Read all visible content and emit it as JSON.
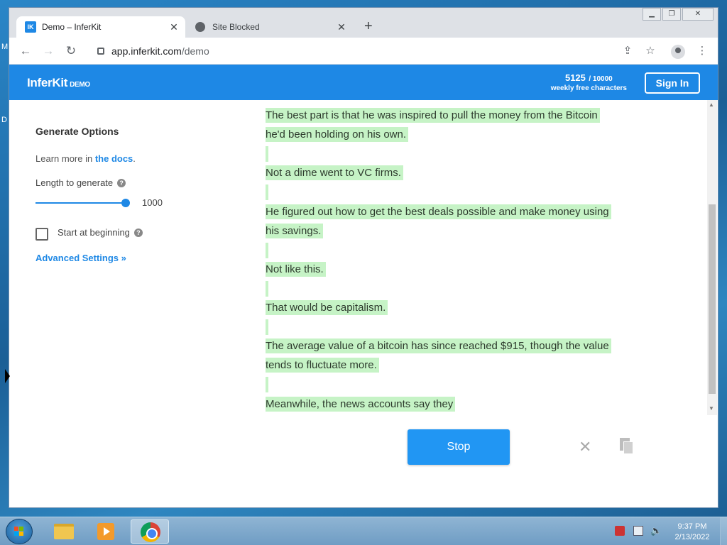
{
  "desktop": {
    "edge_letters": [
      "M",
      "D"
    ]
  },
  "browser": {
    "tabs": [
      {
        "label": "Demo – InferKit",
        "favicon": "IK",
        "active": true
      },
      {
        "label": "Site Blocked",
        "favicon": "globe-icon",
        "active": false
      }
    ],
    "new_tab_glyph": "+",
    "url_host": "app.inferkit.com",
    "url_path": "/demo"
  },
  "app": {
    "brand": "InferKit",
    "brand_tag": "DEMO",
    "credits_used": "5125",
    "credits_max": "/ 10000",
    "credits_label": "weekly free characters",
    "sign_in": "Sign In",
    "accent_color": "#1e88e5"
  },
  "options": {
    "title": "Generate Options",
    "docs_prefix": "Learn more in ",
    "docs_link": "the docs",
    "docs_suffix": ".",
    "length_label": "Length to generate",
    "length_value": "1000",
    "length_fraction": 1.0,
    "start_label": "Start at beginning",
    "start_checked": false,
    "advanced": "Advanced Settings »"
  },
  "output": {
    "lines": [
      "The best part is that he was inspired to pull the money from the Bitcoin",
      "he'd been holding on his own.",
      "",
      "Not a dime went to VC firms.",
      "",
      "He figured out how to get the best deals possible and make money using",
      "his savings.",
      "",
      "Not like this.",
      "",
      "That would be capitalism.",
      "",
      "The average value of a bitcoin has since reached $915, though the value",
      "tends to fluctuate more.",
      "",
      "Meanwhile, the news accounts say they"
    ],
    "highlight_color": "#c6f3c6",
    "stop": "Stop"
  },
  "taskbar": {
    "time": "9:37 PM",
    "date": "2/13/2022"
  }
}
